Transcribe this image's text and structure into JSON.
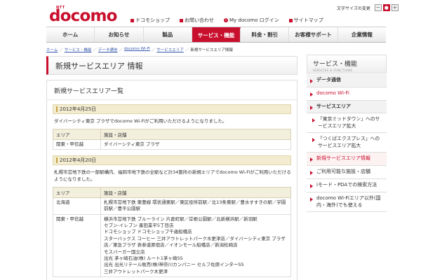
{
  "header": {
    "logo_ntt": "NTT",
    "logo": "docomo",
    "text_size_label": "文字サイズの変更",
    "text_size_small": "－",
    "text_size_reset": "●",
    "text_size_large": "＋",
    "util_links": [
      "ドコモショップ",
      "お問い合わせ",
      "My docomo ログイン",
      "サイトマップ"
    ]
  },
  "nav": {
    "items": [
      "ホーム",
      "お知らせ",
      "製品",
      "サービス・機能",
      "料金・割引",
      "お客様サポート",
      "企業情報"
    ],
    "active_index": 3
  },
  "breadcrumb": {
    "links": [
      "ホーム",
      "サービス・機能",
      "データ通信",
      "docomo Wi-Fi",
      "サービスエリア"
    ],
    "current": "新規サービスエリア情報"
  },
  "page_title": "新規サービスエリア 情報",
  "panel": {
    "title": "新規サービスエリア一覧",
    "sections": [
      {
        "date": "2012年4月25日",
        "note": "ダイバーシティ東京 プラザでdocomo Wi-Fiがご利用いただけるようになりました。",
        "headers": [
          "エリア",
          "施設・店舗"
        ],
        "rows": [
          [
            "関東・甲信越",
            "ダイバーシティ東京 プラザ"
          ]
        ]
      },
      {
        "date": "2012年4月20日",
        "note": "札幌市営地下鉄の一部駅構内、福岡市地下鉄の全駅など計34箇所の新規エリアでdocomo Wi-Fiがご利用いただけるようになりました。",
        "headers": [
          "エリア",
          "施設・店舗"
        ],
        "rows": [
          [
            "北海道",
            "札幌市営地下鉄 東豊線 環状通東駅／東区役所前駅／北13条東駅／豊水すすきの駅／学園前駅／豊平公園駅"
          ],
          [
            "関東・甲信越",
            "横浜市営地下鉄 ブルーライン 片倉町駅／岸根公園駅／北新横浜駅／新羽駅\nセブン-イレブン 墨田業平5丁目店\nドコモショップ ドコモショップ千歳船橋店\nスターバックス コーヒー 三井アウトレットパーク木更津店／ダイバーシティ東京 プラザ店／東急プラザ 表参道原宿店／イオンモール船橋店／新潟松崎店\nモスバーガー国立店\n出光 茅ヶ崎石油(株) ルート1茅ヶ崎SS\n出光 出光リテール販売(株)神奈川カンパニー セルフ佐原インターSS\n三井アウトレットパーク木更津"
          ]
        ]
      }
    ]
  },
  "sidebar": {
    "title": "サービス・機能",
    "subtitle": "SERVICES & FUNCTIONS",
    "items": [
      {
        "label": "データ通信",
        "style": "bold"
      },
      {
        "label": "docomo Wi-Fi",
        "style": "red"
      },
      {
        "label": "サービスエリア",
        "style": "bold"
      },
      {
        "label": "「東京ミッドタウン」へのサービスエリア拡大",
        "style": "sub"
      },
      {
        "label": "「つくばエクスプレス」へのサービスエリア拡大",
        "style": "sub"
      },
      {
        "label": "新規サービスエリア情報",
        "style": "current"
      },
      {
        "label": "ご利用可能な施設・店舗",
        "style": "normal"
      },
      {
        "label": "iモード・PDAでの検索方法",
        "style": "normal"
      },
      {
        "label": "docomo Wi-Fiエリア以外(国内・海外)でも使える",
        "style": "normal"
      }
    ]
  },
  "colors": {
    "brand": "#c8102e",
    "date_bar": "#f4ecd0",
    "table_header": "#f3efdd"
  }
}
